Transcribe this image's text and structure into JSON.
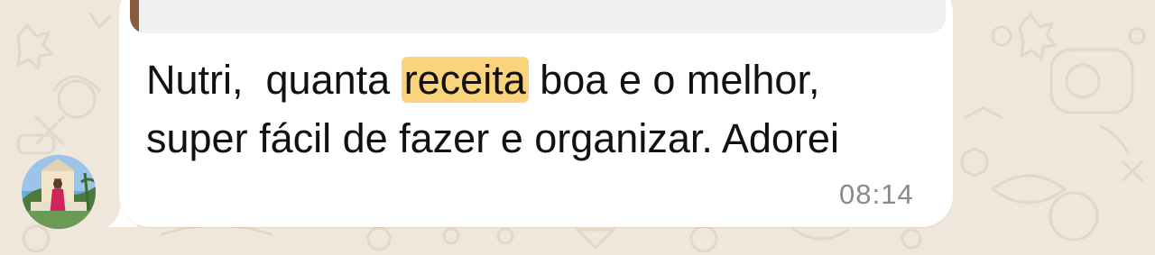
{
  "message": {
    "text_before": "Nutri,  quanta ",
    "highlighted_word": "receita",
    "text_after": " boa e o melhor,\nsuper fácil de fazer e organizar. Adorei",
    "time": "08:14"
  },
  "colors": {
    "chat_background": "#efe7dc",
    "bubble": "#ffffff",
    "search_highlight": "#fbd37a",
    "quote_accent": "#8b5a3c",
    "timestamp": "#8a8a8a"
  },
  "icons": {
    "avatar": "contact-avatar"
  }
}
